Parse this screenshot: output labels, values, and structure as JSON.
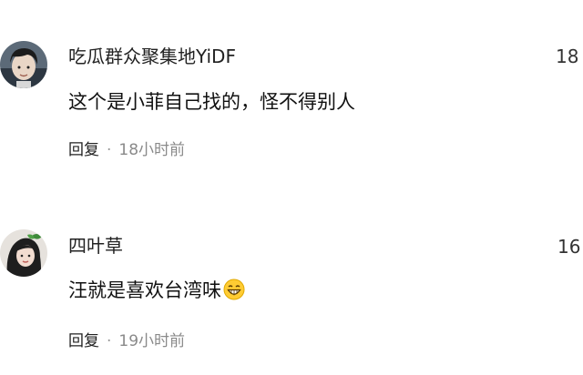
{
  "comments": [
    {
      "username": "吃瓜群众聚集地YiDF",
      "like_count": "18",
      "content": "这个是小菲自己找的，怪不得别人",
      "reply_label": "回复",
      "separator": "·",
      "time": "18小时前"
    },
    {
      "username": "四叶草",
      "like_count": "16",
      "content": "汪就是喜欢台湾味",
      "reply_label": "回复",
      "separator": "·",
      "time": "19小时前",
      "emoji": "grinning-face-emoji"
    }
  ],
  "colors": {
    "text": "#1a1a1a",
    "meta": "#8a8a8a",
    "background": "#ffffff"
  }
}
